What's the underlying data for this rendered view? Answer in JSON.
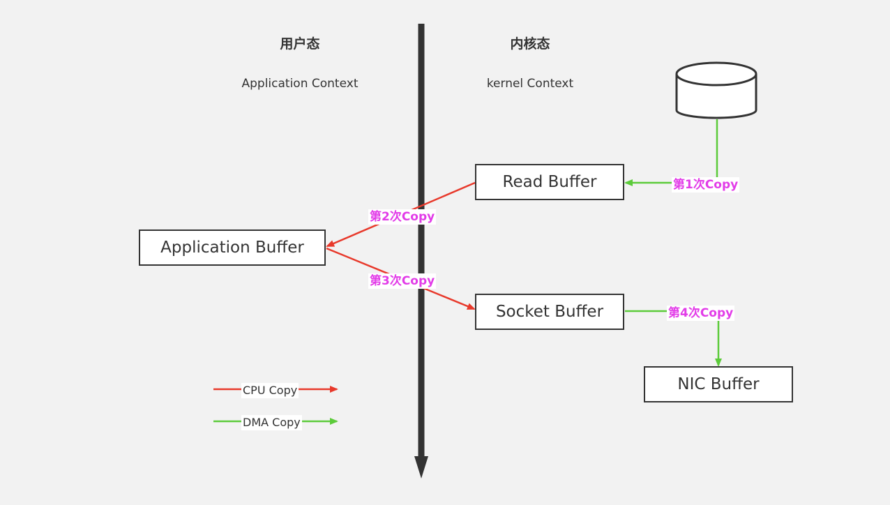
{
  "headers": {
    "user_title": "用户态",
    "user_subtitle": "Application Context",
    "kernel_title": "内核态",
    "kernel_subtitle": "kernel Context"
  },
  "boxes": {
    "read_buffer": "Read Buffer",
    "application_buffer": "Application Buffer",
    "socket_buffer": "Socket Buffer",
    "nic_buffer": "NIC Buffer"
  },
  "copies": {
    "copy1": "第1次Copy",
    "copy2": "第2次Copy",
    "copy3": "第3次Copy",
    "copy4": "第4次Copy"
  },
  "legend": {
    "cpu": "CPU Copy",
    "dma": "DMA Copy"
  },
  "colors": {
    "background": "#f2f2f2",
    "cpu_arrow": "#e8392b",
    "dma_arrow": "#5ccb3a",
    "copy_label": "#e23ce8",
    "divider": "#333333"
  }
}
